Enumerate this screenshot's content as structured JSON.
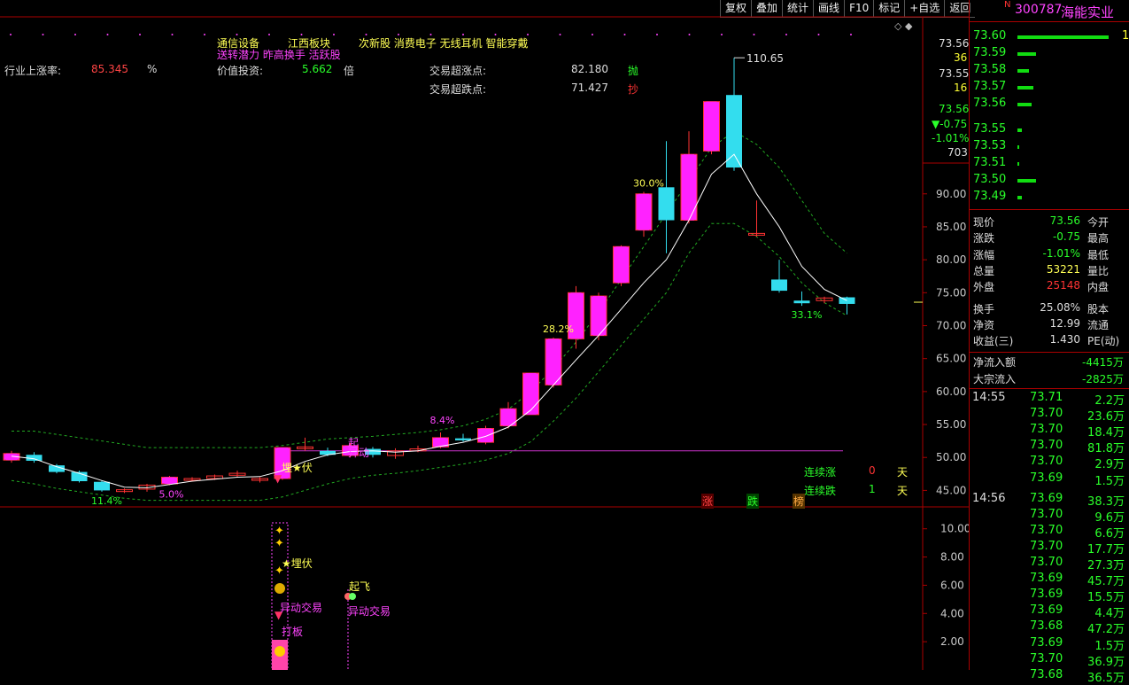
{
  "toolbar": {
    "buttons": [
      "复权",
      "叠加",
      "统计",
      "画线",
      "F10",
      "标记",
      "+自选",
      "返回"
    ]
  },
  "header": {
    "row1": {
      "a": "通信设备",
      "b": "江西板块",
      "c": "次新股 消费电子 无线耳机 智能穿戴"
    },
    "row2": "送转潜力 昨高换手 活跃股",
    "industry_label": "行业上涨率:",
    "industry_value": "85.345",
    "industry_unit": "%",
    "value_label": "价值投资:",
    "value_value": "5.662",
    "value_unit": "倍",
    "over_rise_label": "交易超涨点:",
    "over_rise_value": "82.180",
    "over_rise_tag": "抛",
    "over_fall_label": "交易超跌点:",
    "over_fall_value": "71.427",
    "over_fall_tag": "抄"
  },
  "chart_data": {
    "type": "candlestick",
    "candles": [
      {
        "o": 49.6,
        "c": 50.6,
        "h": 51.0,
        "l": 49.2
      },
      {
        "o": 50.4,
        "c": 49.5,
        "h": 50.8,
        "l": 49.2
      },
      {
        "o": 48.8,
        "c": 47.8,
        "h": 49.0,
        "l": 47.6
      },
      {
        "o": 47.8,
        "c": 46.4,
        "h": 48.0,
        "l": 46.2
      },
      {
        "o": 46.3,
        "c": 45.0,
        "h": 46.5,
        "l": 44.8
      },
      {
        "o": 45.0,
        "c": 45.1,
        "h": 45.3,
        "l": 44.6
      },
      {
        "o": 45.2,
        "c": 45.8,
        "h": 46.0,
        "l": 44.8
      },
      {
        "o": 46.0,
        "c": 47.0,
        "h": 47.2,
        "l": 45.8
      },
      {
        "o": 46.6,
        "c": 46.8,
        "h": 47.0,
        "l": 46.4
      },
      {
        "o": 46.8,
        "c": 47.2,
        "h": 47.4,
        "l": 46.6
      },
      {
        "o": 47.3,
        "c": 47.6,
        "h": 48.0,
        "l": 47.0
      },
      {
        "o": 46.8,
        "c": 46.8,
        "h": 47.0,
        "l": 46.2
      },
      {
        "o": 46.8,
        "c": 51.5,
        "h": 51.5,
        "l": 46.6
      },
      {
        "o": 51.5,
        "c": 51.6,
        "h": 53.0,
        "l": 51.0
      },
      {
        "o": 51.0,
        "c": 50.4,
        "h": 51.5,
        "l": 50.2
      },
      {
        "o": 50.3,
        "c": 51.8,
        "h": 52.2,
        "l": 50.0
      },
      {
        "o": 51.3,
        "c": 50.4,
        "h": 51.6,
        "l": 50.0
      },
      {
        "o": 50.3,
        "c": 51.0,
        "h": 51.4,
        "l": 49.8
      },
      {
        "o": 51.0,
        "c": 51.3,
        "h": 51.8,
        "l": 50.8
      },
      {
        "o": 51.6,
        "c": 53.0,
        "h": 53.8,
        "l": 51.4
      },
      {
        "o": 52.9,
        "c": 52.6,
        "h": 53.6,
        "l": 52.4
      },
      {
        "o": 52.3,
        "c": 54.4,
        "h": 54.8,
        "l": 52.0
      },
      {
        "o": 54.8,
        "c": 57.4,
        "h": 58.4,
        "l": 54.4
      },
      {
        "o": 56.5,
        "c": 62.8,
        "h": 62.8,
        "l": 56.5
      },
      {
        "o": 61.0,
        "c": 68.0,
        "h": 68.2,
        "l": 60.6
      },
      {
        "o": 68.0,
        "c": 75.0,
        "h": 76.0,
        "l": 66.5
      },
      {
        "o": 68.5,
        "c": 74.5,
        "h": 75.0,
        "l": 67.8
      },
      {
        "o": 76.5,
        "c": 82.0,
        "h": 82.2,
        "l": 76.0
      },
      {
        "o": 84.5,
        "c": 90.0,
        "h": 90.3,
        "l": 83.5
      },
      {
        "o": 91.0,
        "c": 86.0,
        "h": 98.0,
        "l": 81.0
      },
      {
        "o": 86.0,
        "c": 96.0,
        "h": 99.5,
        "l": 85.5
      },
      {
        "o": 96.5,
        "c": 104.0,
        "h": 104.0,
        "l": 96.0
      },
      {
        "o": 105.0,
        "c": 94.0,
        "h": 110.65,
        "l": 93.5
      },
      {
        "o": 84.0,
        "c": 84.0,
        "h": 89.0,
        "l": 83.5
      },
      {
        "o": 77.0,
        "c": 75.3,
        "h": 80.0,
        "l": 75.0
      },
      {
        "o": 73.8,
        "c": 73.4,
        "h": 75.2,
        "l": 73.0
      },
      {
        "o": 73.8,
        "c": 74.2,
        "h": 74.4,
        "l": 73.4
      },
      {
        "o": 74.3,
        "c": 73.3,
        "h": 74.4,
        "l": 71.7
      }
    ],
    "ma": [
      50.2,
      49.8,
      48.6,
      47.6,
      46.5,
      45.5,
      45.4,
      45.9,
      46.4,
      46.7,
      47.0,
      47.1,
      48.0,
      49.4,
      50.4,
      50.9,
      51.0,
      50.8,
      51.0,
      51.7,
      52.3,
      53.2,
      54.6,
      57.2,
      61.0,
      64.8,
      68.5,
      72.5,
      76.5,
      80.0,
      86.0,
      93.0,
      96.0,
      90.0,
      85.0,
      79.0,
      75.5,
      73.8
    ],
    "upper_band": [
      54.0,
      54.0,
      53.5,
      53.0,
      52.5,
      52.0,
      51.5,
      51.5,
      51.5,
      51.5,
      51.5,
      51.5,
      51.8,
      52.3,
      52.8,
      53.0,
      53.2,
      53.5,
      53.8,
      54.2,
      54.8,
      55.8,
      57.3,
      60.0,
      63.5,
      67.5,
      72.0,
      77.0,
      82.0,
      87.0,
      92.0,
      97.0,
      99.5,
      97.5,
      94.0,
      89.0,
      84.0,
      81.0
    ],
    "lower_band": [
      46.5,
      46.0,
      45.3,
      44.8,
      44.3,
      43.8,
      43.5,
      43.5,
      43.5,
      43.5,
      43.5,
      43.5,
      44.0,
      45.0,
      46.0,
      46.8,
      47.3,
      47.6,
      48.0,
      48.5,
      49.0,
      49.6,
      50.6,
      52.4,
      55.5,
      59.0,
      63.0,
      67.0,
      71.0,
      75.0,
      81.0,
      85.5,
      85.5,
      83.5,
      80.5,
      76.5,
      73.5,
      71.5
    ],
    "hline_value": 51.0,
    "ylim": [
      42.5,
      113.5
    ],
    "yticks": [
      "90.00",
      "85.00",
      "80.00",
      "75.00",
      "70.00",
      "65.00",
      "60.00",
      "55.00",
      "50.00",
      "45.00"
    ],
    "ytick_values": [
      90,
      85,
      80,
      75,
      70,
      65,
      60,
      55,
      50,
      45
    ],
    "annotations": [
      {
        "text": "11.4%",
        "candle": 4
      },
      {
        "text": "5.0%",
        "candle": 7
      },
      {
        "text": "8.4%",
        "candle": 19
      },
      {
        "text": "28.2%",
        "candle": 24
      },
      {
        "text": "30.0%",
        "candle": 28
      },
      {
        "text": "33.1%",
        "candle": 35
      }
    ],
    "high_label": "110.65",
    "sub_yticks": [
      "10.00",
      "8.00",
      "6.00",
      "4.00",
      "2.00"
    ],
    "sub_ytick_values": [
      10,
      8,
      6,
      4,
      2
    ],
    "sub_ylim": [
      0,
      11.3
    ]
  },
  "axis_top": {
    "p1": "73.56",
    "v1": "36",
    "p2": "73.55",
    "v2": "16",
    "cur": "73.56",
    "chg": "▼-0.75",
    "pct": "-1.01%",
    "vol": "703"
  },
  "signals": {
    "maifu": "埋★伏",
    "qi": "起",
    "yidong": "异动",
    "cont_up_label": "连续涨",
    "cont_up_val": "0",
    "cont_up_unit": "天",
    "cont_dn_label": "连续跌",
    "cont_dn_val": "1",
    "cont_dn_unit": "天",
    "tags": [
      "涨",
      "跌",
      "榜"
    ]
  },
  "sub_signals": {
    "maifu": "★埋伏",
    "yidong1": "异动交易",
    "dabian": "打板",
    "qifei": "起飞",
    "yidong2": "异动交易"
  },
  "stock": {
    "flag": "N",
    "code": "300787",
    "name": "海能实业"
  },
  "orderbook": [
    {
      "price": "73.60",
      "bar": 0.98,
      "vol": "15"
    },
    {
      "price": "73.59",
      "bar": 0.2,
      "vol": ""
    },
    {
      "price": "73.58",
      "bar": 0.12,
      "vol": ""
    },
    {
      "price": "73.57",
      "bar": 0.17,
      "vol": ""
    },
    {
      "price": "73.56",
      "bar": 0.15,
      "vol": ""
    },
    {
      "price": "73.55",
      "bar": 0.05,
      "vol": ""
    },
    {
      "price": "73.53",
      "bar": 0.02,
      "vol": ""
    },
    {
      "price": "73.51",
      "bar": 0.02,
      "vol": ""
    },
    {
      "price": "73.50",
      "bar": 0.2,
      "vol": ""
    },
    {
      "price": "73.49",
      "bar": 0.05,
      "vol": ""
    }
  ],
  "quote": {
    "xianjia_l": "现价",
    "xianjia_v": "73.56",
    "jinkai_l": "今开",
    "zhangdie_l": "涨跌",
    "zhangdie_v": "-0.75",
    "zuigao_l": "最高",
    "zhangfu_l": "涨幅",
    "zhangfu_v": "-1.01%",
    "zuidi_l": "最低",
    "zongliang_l": "总量",
    "zongliang_v": "53221",
    "liangbi_l": "量比",
    "waipan_l": "外盘",
    "waipan_v": "25148",
    "neipan_l": "内盘",
    "huanshou_l": "换手",
    "huanshou_v": "25.08%",
    "guben_l": "股本",
    "jingzi_l": "净资",
    "jingzi_v": "12.99",
    "liutong_l": "流通",
    "shouyi_l": "收益(三)",
    "shouyi_v": "1.430",
    "pe_l": "PE(动)",
    "jingliuru_l": "净流入额",
    "jingliuru_v": "-4415万",
    "dazong_l": "大宗流入",
    "dazong_v": "-2825万"
  },
  "ticks": [
    {
      "t": "14:55",
      "p": "73.71",
      "v": "2.2万"
    },
    {
      "t": "",
      "p": "73.70",
      "v": "23.6万"
    },
    {
      "t": "",
      "p": "73.70",
      "v": "18.4万"
    },
    {
      "t": "",
      "p": "73.70",
      "v": "81.8万"
    },
    {
      "t": "",
      "p": "73.70",
      "v": "2.9万"
    },
    {
      "t": "",
      "p": "73.69",
      "v": "1.5万"
    },
    {
      "t": "14:56",
      "p": "73.69",
      "v": "38.3万"
    },
    {
      "t": "",
      "p": "73.70",
      "v": "9.6万"
    },
    {
      "t": "",
      "p": "73.70",
      "v": "6.6万"
    },
    {
      "t": "",
      "p": "73.70",
      "v": "17.7万"
    },
    {
      "t": "",
      "p": "73.70",
      "v": "27.3万"
    },
    {
      "t": "",
      "p": "73.69",
      "v": "45.7万"
    },
    {
      "t": "",
      "p": "73.69",
      "v": "15.5万"
    },
    {
      "t": "",
      "p": "73.69",
      "v": "4.4万"
    },
    {
      "t": "",
      "p": "73.68",
      "v": "47.2万"
    },
    {
      "t": "",
      "p": "73.69",
      "v": "1.5万"
    },
    {
      "t": "",
      "p": "73.70",
      "v": "36.9万"
    },
    {
      "t": "",
      "p": "73.68",
      "v": "36.5万"
    }
  ],
  "colors": {
    "up": "#ff22ff",
    "down": "#33ddee",
    "ma": "#ffffff",
    "band": "#22aa22",
    "hline": "#cc33cc",
    "green": "#2aff2a",
    "red": "#ff3333"
  }
}
